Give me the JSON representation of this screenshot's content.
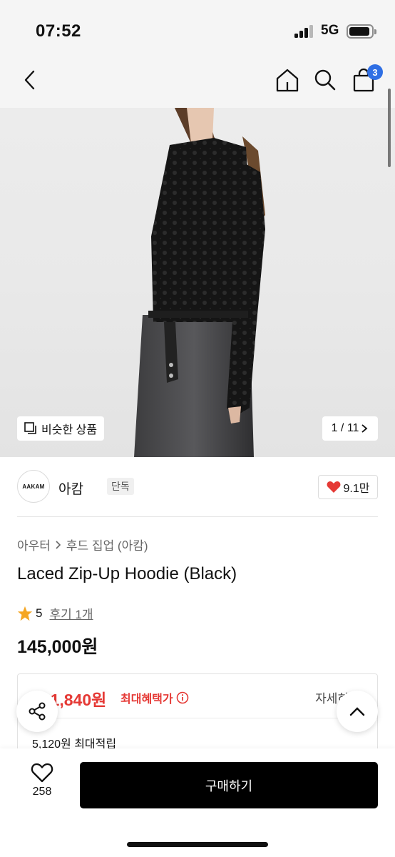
{
  "status_bar": {
    "time": "07:52",
    "network": "5G"
  },
  "nav": {
    "back_icon": "chevron-left-icon",
    "home_icon": "home-icon",
    "search_icon": "search-icon",
    "cart_icon": "shopping-bag-icon",
    "cart_count": "3"
  },
  "gallery": {
    "similar_label": "비슷한 상품",
    "page_indicator": "1 / 11"
  },
  "brand": {
    "logo_text": "AAKAM",
    "name": "아캄",
    "tag": "단독",
    "likes": "9.1만"
  },
  "product": {
    "breadcrumb": [
      "아우터",
      "후드 집업 (아캄)"
    ],
    "title": "Laced Zip-Up Hoodie (Black)",
    "rating": "5",
    "review_label": "후기 1개",
    "price": "145,000원"
  },
  "benefit": {
    "max_benefit_price": "131,840원",
    "max_benefit_label": "최대혜택가",
    "detail_label": "자세히",
    "points": "5,120원 최대적립"
  },
  "bottom_bar": {
    "wish_count": "258",
    "buy_label": "구매하기"
  },
  "colors": {
    "accent_red": "#e53935",
    "badge_blue": "#2f6fe4",
    "star": "#f5a623"
  }
}
